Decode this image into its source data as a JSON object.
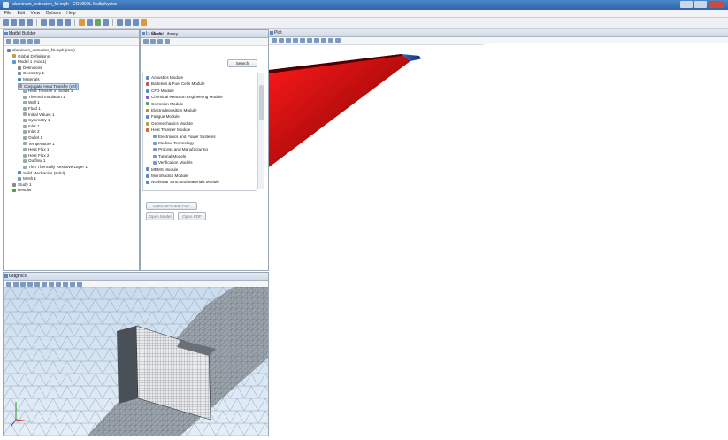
{
  "window": {
    "title": "aluminum_extrusion_fsi.mph - COMSOL Multiphysics"
  },
  "menu": [
    "File",
    "Edit",
    "View",
    "Options",
    "Help"
  ],
  "model_builder": {
    "title": "Model Builder",
    "tree": [
      {
        "label": "aluminum_extrusion_fsi.mph (root)",
        "indent": 0,
        "color": "#5a7fb5"
      },
      {
        "label": "Global Definitions",
        "indent": 1,
        "color": "#c0a040"
      },
      {
        "label": "Model 1 (mod1)",
        "indent": 1,
        "color": "#5a9ad0"
      },
      {
        "label": "Definitions",
        "indent": 2,
        "color": "#7a8a9a"
      },
      {
        "label": "Geometry 1",
        "indent": 2,
        "color": "#7a8a9a"
      },
      {
        "label": "Materials",
        "indent": 2,
        "color": "#3a8fc0"
      },
      {
        "label": "Conjugate Heat Transfer (nitf)",
        "indent": 2,
        "color": "#d08a30",
        "selected": true
      },
      {
        "label": "Heat Transfer in Solids 1",
        "indent": 3,
        "color": "#9aa"
      },
      {
        "label": "Thermal Insulation 1",
        "indent": 3,
        "color": "#9aa"
      },
      {
        "label": "Wall 1",
        "indent": 3,
        "color": "#9aa"
      },
      {
        "label": "Fluid 1",
        "indent": 3,
        "color": "#9aa"
      },
      {
        "label": "Initial Values 1",
        "indent": 3,
        "color": "#9aa"
      },
      {
        "label": "Symmetry 1",
        "indent": 3,
        "color": "#9aa"
      },
      {
        "label": "Inlet 1",
        "indent": 3,
        "color": "#9aa"
      },
      {
        "label": "Inlet 2",
        "indent": 3,
        "color": "#9aa"
      },
      {
        "label": "Outlet 1",
        "indent": 3,
        "color": "#9aa"
      },
      {
        "label": "Temperature 1",
        "indent": 3,
        "color": "#9aa"
      },
      {
        "label": "Heat Flux 1",
        "indent": 3,
        "color": "#9aa"
      },
      {
        "label": "Heat Flux 2",
        "indent": 3,
        "color": "#9aa"
      },
      {
        "label": "Outflow 1",
        "indent": 3,
        "color": "#9aa"
      },
      {
        "label": "Thin Thermally Resistive Layer 1",
        "indent": 3,
        "color": "#9aa"
      },
      {
        "label": "Solid Mechanics (solid)",
        "indent": 2,
        "color": "#4a8ad0"
      },
      {
        "label": "Mesh 1",
        "indent": 2,
        "color": "#6a9ac0"
      },
      {
        "label": "Study 1",
        "indent": 1,
        "color": "#8a8a8a"
      },
      {
        "label": "Results",
        "indent": 1,
        "color": "#4aa04a"
      }
    ]
  },
  "model_library": {
    "title": "Mesh",
    "tab2": "Model Library",
    "search_label": "Search",
    "items": [
      {
        "label": "Acoustics Module",
        "indent": 0,
        "color": "#5a8ac0"
      },
      {
        "label": "Batteries & Fuel Cells Module",
        "indent": 0,
        "color": "#c05a5a"
      },
      {
        "label": "CFD Module",
        "indent": 0,
        "color": "#5a8ac0"
      },
      {
        "label": "Chemical Reaction Engineering Module",
        "indent": 0,
        "color": "#8a5ac0"
      },
      {
        "label": "Corrosion Module",
        "indent": 0,
        "color": "#5aa05a"
      },
      {
        "label": "Electrodeposition Module",
        "indent": 0,
        "color": "#c08a3a"
      },
      {
        "label": "Fatigue Module",
        "indent": 0,
        "color": "#5a8ac0"
      },
      {
        "label": "Geomechanics Module",
        "indent": 0,
        "color": "#c0a040"
      },
      {
        "label": "Heat Transfer Module",
        "indent": 0,
        "color": "#d06a3a"
      },
      {
        "label": "Electronics and Power Systems",
        "indent": 1,
        "color": "#7a9ac0"
      },
      {
        "label": "Medical Technology",
        "indent": 1,
        "color": "#7a9ac0"
      },
      {
        "label": "Process and Manufacturing",
        "indent": 1,
        "color": "#7a9ac0"
      },
      {
        "label": "Tutorial Models",
        "indent": 1,
        "color": "#7a9ac0"
      },
      {
        "label": "Verification Models",
        "indent": 1,
        "color": "#7a9ac0"
      },
      {
        "label": "MEMS Module",
        "indent": 0,
        "color": "#5a8ac0"
      },
      {
        "label": "Microfluidics Module",
        "indent": 0,
        "color": "#5a8ac0"
      },
      {
        "label": "Nonlinear Structural Materials Module",
        "indent": 0,
        "color": "#5a8ac0"
      }
    ],
    "buttons": {
      "open_pdf": "Open MPH and PDF",
      "open_model": "Open Model",
      "open_pdf2": "Open PDF"
    }
  },
  "graphics": {
    "title": "Graphics"
  },
  "plot_tab": {
    "title": "Plot"
  }
}
